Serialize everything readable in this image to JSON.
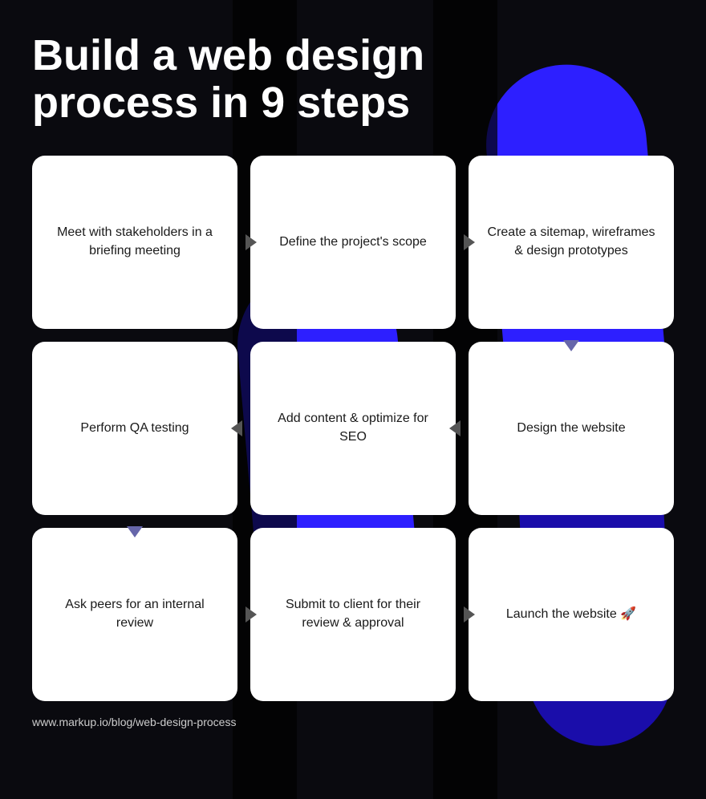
{
  "title": "Build a web design process in 9 steps",
  "cards": [
    {
      "id": "step1",
      "text": "Meet with stakeholders in a briefing meeting",
      "row": 1,
      "col": 1,
      "arrow_right": true,
      "arrow_down": false,
      "arrow_left": false
    },
    {
      "id": "step2",
      "text": "Define the project's scope",
      "row": 1,
      "col": 2,
      "arrow_right": true,
      "arrow_down": false,
      "arrow_left": false
    },
    {
      "id": "step3",
      "text": "Create a sitemap, wireframes & design prototypes",
      "row": 1,
      "col": 3,
      "arrow_right": false,
      "arrow_down": true,
      "arrow_left": false
    },
    {
      "id": "step4",
      "text": "Perform QA testing",
      "row": 2,
      "col": 1,
      "arrow_right": false,
      "arrow_down": true,
      "arrow_left": false
    },
    {
      "id": "step5",
      "text": "Add content & optimize for SEO",
      "row": 2,
      "col": 2,
      "arrow_right": false,
      "arrow_down": false,
      "arrow_left": true
    },
    {
      "id": "step6",
      "text": "Design the website",
      "row": 2,
      "col": 3,
      "arrow_right": false,
      "arrow_down": false,
      "arrow_left": true
    },
    {
      "id": "step7",
      "text": "Ask peers for an internal review",
      "row": 3,
      "col": 1,
      "arrow_right": true,
      "arrow_down": false,
      "arrow_left": false
    },
    {
      "id": "step8",
      "text": "Submit to client for their review & approval",
      "row": 3,
      "col": 2,
      "arrow_right": true,
      "arrow_down": false,
      "arrow_left": false
    },
    {
      "id": "step9",
      "text": "Launch the website 🚀",
      "row": 3,
      "col": 3,
      "arrow_right": false,
      "arrow_down": false,
      "arrow_left": false
    }
  ],
  "footer": {
    "url": "www.markup.io/blog/web-design-process"
  }
}
